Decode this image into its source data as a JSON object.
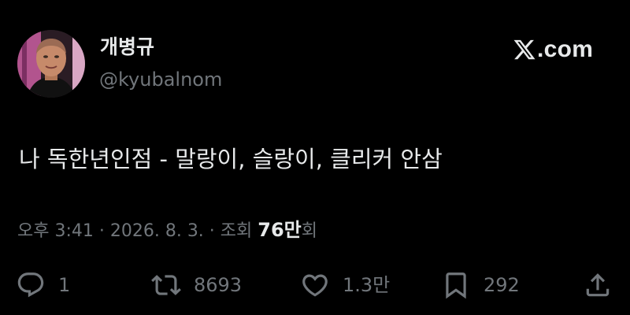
{
  "user": {
    "display_name": "개병규",
    "handle": "@kyubalnom",
    "avatar_icon": "profile-photo"
  },
  "brand": {
    "logo_icon": "x-logo-icon",
    "domain_text": ".com"
  },
  "tweet": {
    "text": "나 독한년인점 - 말랑이, 슬랑이, 클리커 안삼"
  },
  "meta": {
    "timestamp": "오후 3:41 · 2026. 8. 3. · 조회 ",
    "views_count": "76만",
    "views_suffix": "회"
  },
  "actions": {
    "reply": {
      "icon": "reply-icon",
      "count": "1"
    },
    "repost": {
      "icon": "repost-icon",
      "count": "8693"
    },
    "like": {
      "icon": "heart-icon",
      "count": "1.3만"
    },
    "bookmark": {
      "icon": "bookmark-icon",
      "count": "292"
    },
    "share": {
      "icon": "share-icon"
    }
  },
  "colors": {
    "background": "#000000",
    "primary_text": "#e7e9ea",
    "secondary_text": "#71767b"
  }
}
